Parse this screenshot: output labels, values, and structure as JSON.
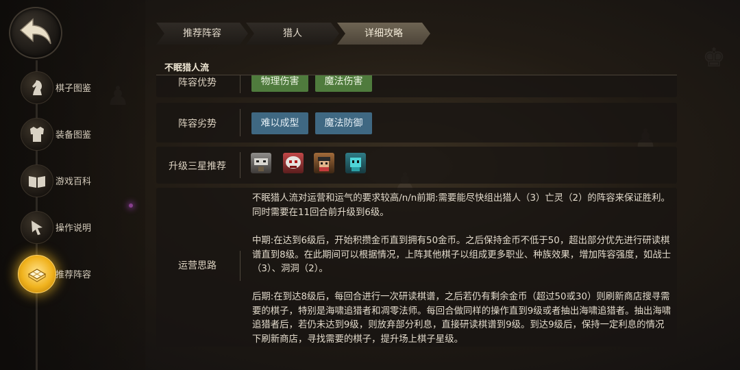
{
  "sidebar": {
    "back_icon": "back-arrow-icon",
    "items": [
      {
        "label": "棋子图鉴",
        "icon": "knight-icon",
        "active": false
      },
      {
        "label": "装备图鉴",
        "icon": "armor-icon",
        "active": false
      },
      {
        "label": "游戏百科",
        "icon": "book-icon",
        "active": false
      },
      {
        "label": "操作说明",
        "icon": "pointer-hand-icon",
        "active": false
      },
      {
        "label": "推荐阵容",
        "icon": "board-icon",
        "active": true
      }
    ]
  },
  "tabs": [
    {
      "label": "推荐阵容",
      "active": false
    },
    {
      "label": "猎人",
      "active": false
    },
    {
      "label": "详细攻略",
      "active": true
    }
  ],
  "section_title": "不眠猎人流",
  "rows": {
    "advantage": {
      "label": "阵容优势",
      "tags": [
        "物理伤害",
        "魔法伤害"
      ],
      "tag_color": "#4f7b3d"
    },
    "disadvantage": {
      "label": "阵容劣势",
      "tags": [
        "难以成型",
        "魔法防御"
      ],
      "tag_color": "#3f6882"
    },
    "upgrade": {
      "label": "升级三星推荐",
      "pieces": [
        "hero-portrait-1-icon",
        "hero-portrait-2-icon",
        "hero-portrait-3-icon",
        "hero-portrait-4-icon"
      ]
    },
    "strategy": {
      "label": "运营思路",
      "paragraphs": [
        "不眠猎人流对运营和运气的要求较高/n/n前期:需要能尽快组出猎人（3）亡灵（2）的阵容来保证胜利。同时需要在11回合前升级到6级。",
        "中期:在达到6级后，开始积攒金币直到拥有50金币。之后保持金币不低于50，超出部分优先进行研读棋谱直到8级。在此期间可以根据情况，上阵其他棋子以组成更多职业、种族效果，增加阵容强度，如战士（3）、洞洞（2）。",
        "后期:在到达8级后，每回合进行一次研读棋谱，之后若仍有剩余金币（超过50或30）则刷新商店搜寻需要的棋子，特别是海啸追猎者和凋零法师。每回合做同样的操作直到9级或者抽出海啸追猎者。抽出海啸追猎者后，若仍未达到9级，则放弃部分利息，直接研读棋谱到9级。到达9级后，保持一定利息的情况下刷新商店，寻找需要的棋子，提升场上棋子星级。"
      ]
    }
  },
  "colors": {
    "accent_gold": "#f0b21d",
    "tag_green": "#4f7b3d",
    "tag_blue": "#3f6882",
    "active_tab": "#5e5547"
  }
}
